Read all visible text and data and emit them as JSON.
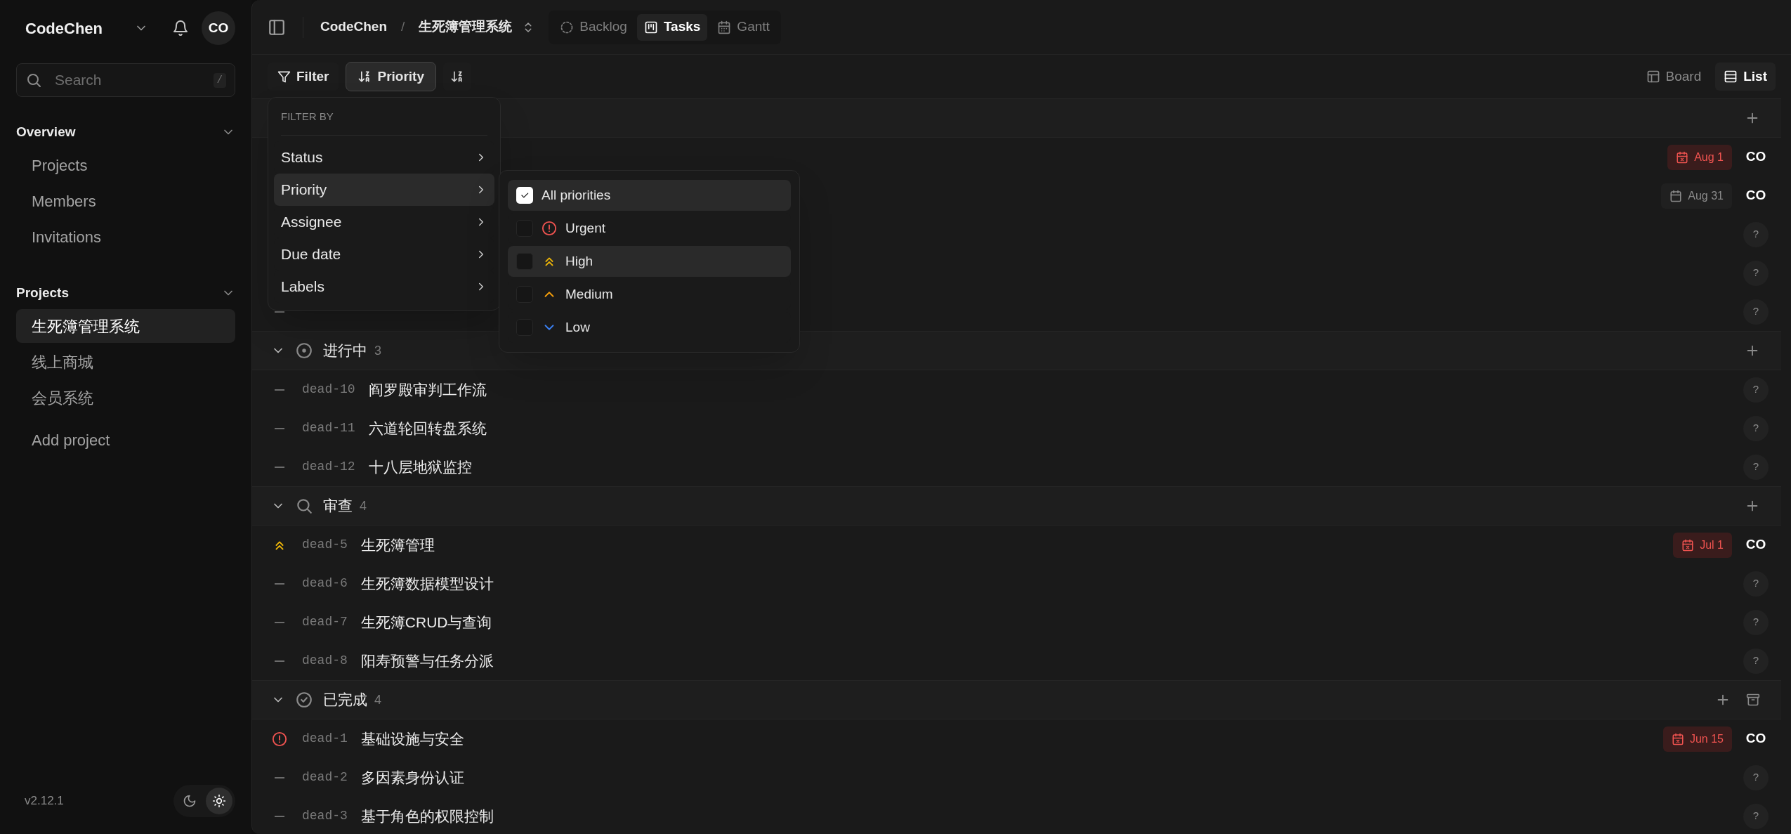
{
  "sidebar": {
    "workspace": "CodeChen",
    "avatar": "CO",
    "search": {
      "placeholder": "Search",
      "shortcut": "/"
    },
    "sections": [
      {
        "title": "Overview",
        "expanded": true,
        "items": [
          {
            "label": "Projects",
            "selected": false
          },
          {
            "label": "Members",
            "selected": false
          },
          {
            "label": "Invitations",
            "selected": false
          }
        ]
      },
      {
        "title": "Projects",
        "expanded": true,
        "items": [
          {
            "label": "生死簿管理系统",
            "selected": true
          },
          {
            "label": "线上商城",
            "selected": false
          },
          {
            "label": "会员系统",
            "selected": false
          }
        ]
      }
    ],
    "add_project": "Add project",
    "version": "v2.12.1",
    "theme": [
      {
        "kind": "dark",
        "selected": false
      },
      {
        "kind": "light",
        "selected": true
      }
    ]
  },
  "breadcrumb": [
    "CodeChen",
    "/",
    "生死簿管理系统"
  ],
  "views": [
    {
      "label": "Backlog",
      "kind": "backlog",
      "selected": false
    },
    {
      "label": "Tasks",
      "kind": "tasks",
      "selected": true
    },
    {
      "label": "Gantt",
      "kind": "gantt",
      "selected": false
    }
  ],
  "toolbar": {
    "filter": "Filter",
    "sort": "Priority",
    "layouts": [
      {
        "label": "Board",
        "kind": "board",
        "selected": false
      },
      {
        "label": "List",
        "kind": "list",
        "selected": true
      }
    ]
  },
  "groups": [
    {
      "rows": [
        {
          "due": "Aug 1",
          "overdue": true,
          "assignee": "CO"
        },
        {
          "due": "Aug 31",
          "overdue": false,
          "assignee": "CO"
        },
        {
          "assignee": "?"
        },
        {
          "assignee": "?"
        },
        {
          "kind": "none",
          "assignee": "?"
        }
      ]
    },
    {
      "kind": "in_progress",
      "title": "进行中",
      "count": "3",
      "rows": [
        {
          "kind": "none",
          "id": "dead-10",
          "title": "阎罗殿审判工作流",
          "assignee": "?"
        },
        {
          "kind": "none",
          "id": "dead-11",
          "title": "六道轮回转盘系统",
          "assignee": "?"
        },
        {
          "kind": "none",
          "id": "dead-12",
          "title": "十八层地狱监控",
          "assignee": "?"
        }
      ]
    },
    {
      "kind": "review",
      "title": "审查",
      "count": "4",
      "rows": [
        {
          "kind": "high",
          "id": "dead-5",
          "title": "生死簿管理",
          "due": "Jul 1",
          "overdue": true,
          "assignee": "CO"
        },
        {
          "kind": "none",
          "id": "dead-6",
          "title": "生死簿数据模型设计",
          "assignee": "?"
        },
        {
          "kind": "none",
          "id": "dead-7",
          "title": "生死簿CRUD与查询",
          "assignee": "?"
        },
        {
          "kind": "none",
          "id": "dead-8",
          "title": "阳寿预警与任务分派",
          "assignee": "?"
        }
      ]
    },
    {
      "kind": "done",
      "title": "已完成",
      "count": "4",
      "archive": true,
      "rows": [
        {
          "kind": "urgent",
          "id": "dead-1",
          "title": "基础设施与安全",
          "due": "Jun 15",
          "overdue": true,
          "assignee": "CO"
        },
        {
          "kind": "none",
          "id": "dead-2",
          "title": "多因素身份认证",
          "assignee": "?"
        },
        {
          "kind": "none",
          "id": "dead-3",
          "title": "基于角色的权限控制",
          "assignee": "?"
        }
      ]
    }
  ],
  "filter_menu": {
    "header": "FILTER BY",
    "items": [
      {
        "label": "Status",
        "selected": false
      },
      {
        "label": "Priority",
        "selected": true
      },
      {
        "label": "Assignee",
        "selected": false
      },
      {
        "label": "Due date",
        "selected": false
      },
      {
        "label": "Labels",
        "selected": false
      }
    ],
    "submenu": [
      {
        "label": "All priorities",
        "kind": "all",
        "checked": true,
        "highlighted": true
      },
      {
        "label": "Urgent",
        "kind": "urgent",
        "checked": false,
        "highlighted": false
      },
      {
        "label": "High",
        "kind": "high",
        "checked": false,
        "highlighted": true
      },
      {
        "label": "Medium",
        "kind": "medium",
        "checked": false,
        "highlighted": false
      },
      {
        "label": "Low",
        "kind": "low",
        "checked": false,
        "highlighted": false
      }
    ]
  }
}
